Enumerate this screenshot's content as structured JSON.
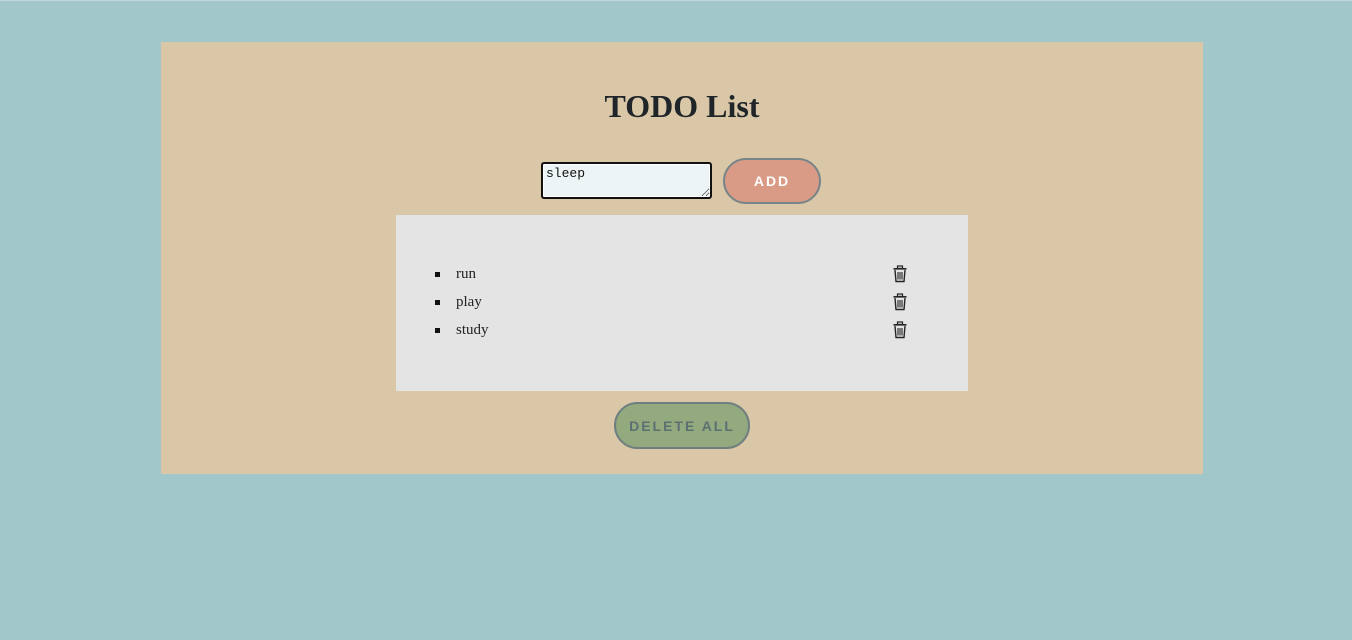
{
  "app": {
    "title": "TODO List"
  },
  "input": {
    "value": "sleep"
  },
  "buttons": {
    "add_label": "ADD",
    "delete_all_label": "DELETE ALL"
  },
  "todos": [
    {
      "label": "run",
      "delete_icon": "trash-icon"
    },
    {
      "label": "play",
      "delete_icon": "trash-icon"
    },
    {
      "label": "study",
      "delete_icon": "trash-icon"
    }
  ],
  "colors": {
    "page_background": "#a2c7cb",
    "card_background": "#d9c7a8",
    "list_background": "#e4e4e4",
    "add_button": "#d99b86",
    "delete_all_button": "#93a97e",
    "input_background": "#edf4f6"
  }
}
